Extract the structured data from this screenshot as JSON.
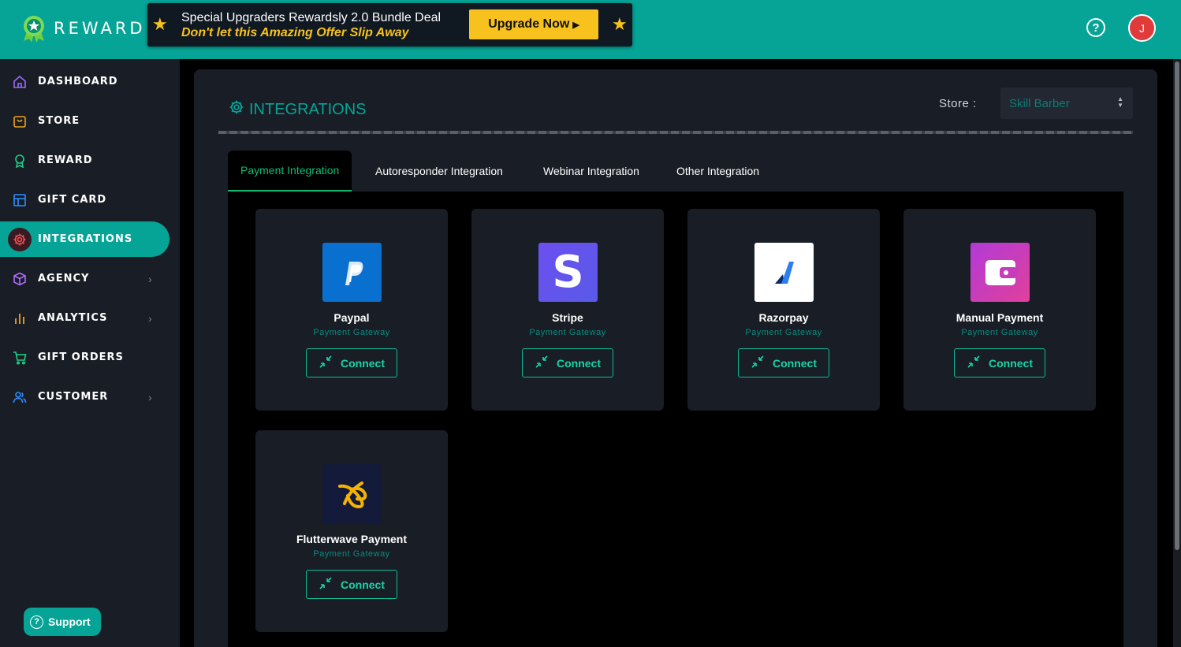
{
  "header": {
    "logo_text": "REWARD",
    "promo": {
      "line1": "Special Upgraders Rewardsly 2.0 Bundle Deal",
      "line2": "Don't let this Amazing Offer Slip Away",
      "button_label": "Upgrade Now"
    },
    "help_icon": "question-circle-icon",
    "avatar_initial": "J"
  },
  "sidebar": {
    "items": [
      {
        "label": "DASHBOARD",
        "icon": "home-icon",
        "has_chevron": false
      },
      {
        "label": "STORE",
        "icon": "store-bag-icon",
        "has_chevron": false
      },
      {
        "label": "REWARD",
        "icon": "award-icon",
        "has_chevron": false
      },
      {
        "label": "GIFT CARD",
        "icon": "card-layout-icon",
        "has_chevron": false
      },
      {
        "label": "INTEGRATIONS",
        "icon": "gear-icon",
        "has_chevron": false,
        "active": true
      },
      {
        "label": "AGENCY",
        "icon": "cube-icon",
        "has_chevron": true
      },
      {
        "label": "ANALYTICS",
        "icon": "bar-chart-icon",
        "has_chevron": true
      },
      {
        "label": "GIFT ORDERS",
        "icon": "cart-icon",
        "has_chevron": false
      },
      {
        "label": "CUSTOMER",
        "icon": "users-icon",
        "has_chevron": true
      }
    ],
    "support_label": "Support"
  },
  "main": {
    "title": "INTEGRATIONS",
    "store_label": "Store :",
    "store_value": "Skill Barber",
    "tabs": [
      {
        "label": "Payment Integration",
        "active": true
      },
      {
        "label": "Autoresponder Integration"
      },
      {
        "label": "Webinar Integration"
      },
      {
        "label": "Other Integration"
      }
    ],
    "cards": [
      {
        "name": "Paypal",
        "subtitle": "Payment Gateway",
        "button": "Connect",
        "logo": "paypal-logo-icon"
      },
      {
        "name": "Stripe",
        "subtitle": "Payment Gateway",
        "button": "Connect",
        "logo": "stripe-logo-icon"
      },
      {
        "name": "Razorpay",
        "subtitle": "Payment Gateway",
        "button": "Connect",
        "logo": "razorpay-logo-icon"
      },
      {
        "name": "Manual Payment",
        "subtitle": "Payment Gateway",
        "button": "Connect",
        "logo": "wallet-logo-icon"
      },
      {
        "name": "Flutterwave Payment",
        "subtitle": "Payment Gateway",
        "button": "Connect",
        "logo": "flutterwave-logo-icon"
      }
    ]
  },
  "colors": {
    "accent": "#05a496",
    "promo_yellow": "#f7c21d",
    "tab_active": "#0fbc73",
    "connect": "#19d3a8"
  }
}
